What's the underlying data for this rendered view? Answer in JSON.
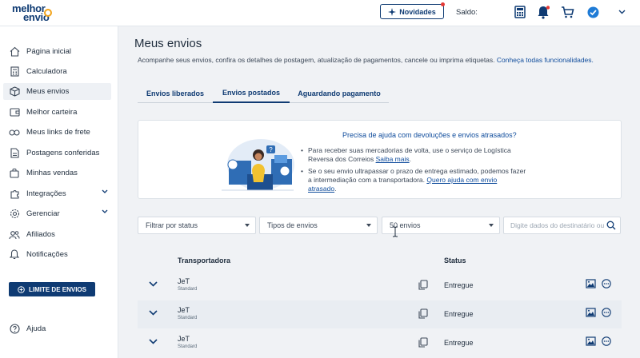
{
  "header": {
    "logo_line1": "melhor",
    "logo_line2": "envio",
    "novidades_label": "Novidades",
    "saldo_label": "Saldo:"
  },
  "sidebar": {
    "items": [
      {
        "label": "Página inicial",
        "icon": "home-icon"
      },
      {
        "label": "Calculadora",
        "icon": "calculator-icon"
      },
      {
        "label": "Meus envios",
        "icon": "box-icon",
        "active": true
      },
      {
        "label": "Melhor carteira",
        "icon": "wallet-icon"
      },
      {
        "label": "Meus links de frete",
        "icon": "link-icon"
      },
      {
        "label": "Postagens conferidas",
        "icon": "document-icon"
      },
      {
        "label": "Minhas vendas",
        "icon": "bag-icon"
      },
      {
        "label": "Integrações",
        "icon": "puzzle-icon",
        "expandable": true
      },
      {
        "label": "Gerenciar",
        "icon": "gear-icon",
        "expandable": true
      },
      {
        "label": "Afiliados",
        "icon": "users-icon"
      },
      {
        "label": "Notificações",
        "icon": "bell-icon"
      }
    ],
    "limite_label": "LIMITE DE ENVIOS",
    "ajuda_label": "Ajuda"
  },
  "main": {
    "title": "Meus envios",
    "subtitle": "Acompanhe seus envios, confira os detalhes de postagem, atualização de pagamentos, cancele ou imprima etiquetas.",
    "subtitle_link": "Conheça todas funcionalidades.",
    "tabs": [
      {
        "label": "Envios liberados"
      },
      {
        "label": "Envios postados",
        "active": true
      },
      {
        "label": "Aguardando pagamento"
      }
    ],
    "help": {
      "title": "Precisa de ajuda com devoluções e envios atrasados?",
      "bullet1_line1": "Para receber suas mercadorias de volta, use o serviço de Logística",
      "bullet1_line2": "Reversa dos Correios",
      "bullet1_link": "Saiba mais",
      "bullet2_line1": "Se o seu envio ultrapassar o prazo de entrega estimado, podemos fazer",
      "bullet2_line2": "a intermediação com a transportadora.",
      "bullet2_link": "Quero ajuda com envio",
      "bullet2_link2": "atrasado"
    },
    "filters": {
      "status": "Filtrar por status",
      "tipos": "Tipos de envios",
      "quantidade": "50 envios",
      "search_placeholder": "Digite dados do destinatário ou"
    },
    "table": {
      "headers": {
        "carrier": "Transportadora",
        "status": "Status"
      },
      "rows": [
        {
          "carrier": "JeT",
          "service": "Standard",
          "status": "Entregue"
        },
        {
          "carrier": "JeT",
          "service": "Standard",
          "status": "Entregue"
        },
        {
          "carrier": "JeT",
          "service": "Standard",
          "status": "Entregue"
        }
      ]
    }
  },
  "colors": {
    "primary": "#0f3b73",
    "accent": "#f2a41c",
    "link": "#0f4c9c",
    "badge": "#e53935"
  }
}
